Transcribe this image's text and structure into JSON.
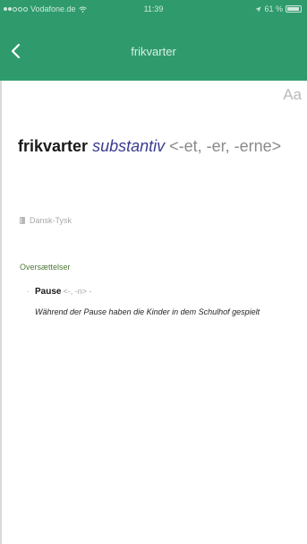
{
  "status_bar": {
    "carrier": "Vodafone.de",
    "time": "11:39",
    "battery": "61 %"
  },
  "nav": {
    "title": "frikvarter",
    "back_icon": "chevron-left-icon"
  },
  "font_size_label": "Aa",
  "entry": {
    "headword": "frikvarter",
    "part_of_speech": "substantiv",
    "inflection": "<-et, -er, -erne>"
  },
  "dictionary": {
    "name": "Dansk-Tysk",
    "icon": "book-icon"
  },
  "translations": {
    "section_label": "Oversættelser",
    "items": [
      {
        "word": "Pause",
        "grammar": "<-, -n> -",
        "example": "Während der Pause haben die Kinder in dem Schulhof gespielt"
      }
    ]
  },
  "colors": {
    "header": "#2f9b6c",
    "headword": "#1a1a1a",
    "part_of_speech": "#3a3a8f",
    "section_label": "#4f7a3a"
  }
}
